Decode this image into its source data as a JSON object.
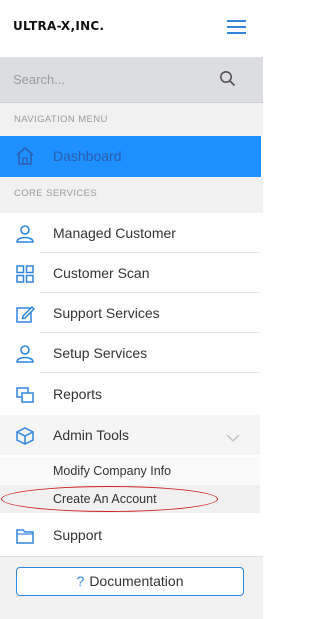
{
  "brand": {
    "logo_text": "ULTRA-X,INC."
  },
  "search": {
    "placeholder": "Search..."
  },
  "sections": {
    "navigation": "NAVIGATION MENU",
    "core": "CORE SERVICES"
  },
  "nav": {
    "dashboard": "Dashboard",
    "items": [
      {
        "label": "Managed Customer",
        "icon": "user-icon"
      },
      {
        "label": "Customer Scan",
        "icon": "grid-icon"
      },
      {
        "label": "Support Services",
        "icon": "edit-icon"
      },
      {
        "label": "Setup Services",
        "icon": "user-icon"
      },
      {
        "label": "Reports",
        "icon": "reports-icon"
      },
      {
        "label": "Admin Tools",
        "icon": "cube-icon"
      }
    ],
    "admin_submenu": [
      "Modify Company Info",
      "Create An Account"
    ],
    "support": "Support"
  },
  "footer": {
    "documentation_label": "Documentation",
    "documentation_icon": "question-icon"
  },
  "colors": {
    "accent": "#1e90ff",
    "brand_blue": "#2e86de",
    "annotation": "#cc1f1f"
  }
}
